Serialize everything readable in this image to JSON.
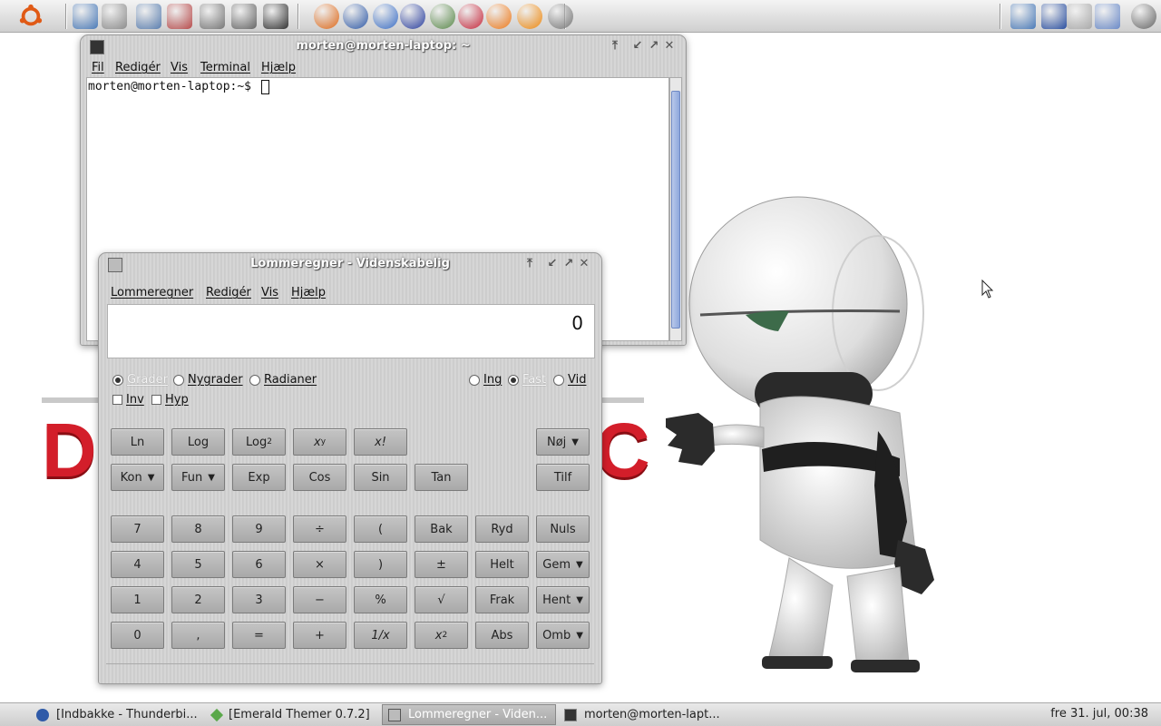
{
  "top_panel": {
    "launchers": [
      {
        "icon": "ubuntu-menu-icon",
        "color": "#e05a16"
      },
      {
        "icon": "home-folder-icon",
        "color": "#4a7ab8"
      },
      {
        "icon": "trash-icon",
        "color": "#8d8d8d"
      },
      {
        "icon": "computer-icon",
        "color": "#5b7fb0"
      },
      {
        "icon": "package-manager-icon",
        "color": "#b84b4b"
      },
      {
        "icon": "printer-icon",
        "color": "#777777"
      },
      {
        "icon": "settings-gear-icon",
        "color": "#666666"
      },
      {
        "icon": "terminal-icon",
        "color": "#333333"
      },
      {
        "icon": "firefox-icon",
        "color": "#e06a1a"
      },
      {
        "icon": "thunderbird-icon",
        "color": "#2f5aa8"
      },
      {
        "icon": "google-earth-icon",
        "color": "#3b6fc7"
      },
      {
        "icon": "gnome-foot-icon",
        "color": "#2a3fa0"
      },
      {
        "icon": "users-icon",
        "color": "#5a8a4a"
      },
      {
        "icon": "miro-icon",
        "color": "#c8283c"
      },
      {
        "icon": "phoenix-icon",
        "color": "#f07a1a"
      },
      {
        "icon": "vlc-cone-icon",
        "color": "#f08a10"
      },
      {
        "icon": "calculator-icon",
        "color": "#777777"
      }
    ],
    "tray": [
      {
        "icon": "desktop-icon",
        "color": "#4a7ab8"
      },
      {
        "icon": "network-signal-icon",
        "color": "#2a4fa0"
      },
      {
        "icon": "brightness-sun-icon",
        "color": "#aaaaaa"
      },
      {
        "icon": "display-switch-icon",
        "color": "#6a8ac8"
      },
      {
        "icon": "power-icon",
        "color": "#666666"
      }
    ]
  },
  "terminal": {
    "title": "morten@morten-laptop: ~",
    "menu": [
      "Fil",
      "Redigér",
      "Vis",
      "Terminal",
      "Hjælp"
    ],
    "prompt": "morten@morten-laptop:~$"
  },
  "calculator": {
    "title": "Lommeregner - Videnskabelig",
    "menu": [
      "Lommeregner",
      "Redigér",
      "Vis",
      "Hjælp"
    ],
    "display": "0",
    "angle_units": {
      "options": [
        "Grader",
        "Nygrader",
        "Radianer"
      ],
      "selected": "Grader"
    },
    "modifiers": [
      "Inv",
      "Hyp"
    ],
    "notation": {
      "options": [
        "Ing",
        "Fast",
        "Vid"
      ],
      "selected": "Fast"
    },
    "function_rows": [
      [
        "Ln",
        "Log",
        "Log",
        "x",
        "x!"
      ],
      [
        "Kon",
        "Fun",
        "Exp",
        "Cos",
        "Sin",
        "Tan"
      ]
    ],
    "log2_sub": "2",
    "xy_sup": "y",
    "right_buttons": [
      "Nøj",
      "Tilf"
    ],
    "keypad": [
      [
        "7",
        "8",
        "9",
        "÷",
        "(",
        "Bak",
        "Ryd",
        "Nuls"
      ],
      [
        "4",
        "5",
        "6",
        "×",
        ")",
        "±",
        "Helt",
        "Gem"
      ],
      [
        "1",
        "2",
        "3",
        "−",
        "%",
        "√",
        "Frak",
        "Hent"
      ],
      [
        "0",
        ",",
        "=",
        "+",
        "1/x",
        "x",
        "Abs",
        "Omb"
      ]
    ],
    "x2_sup": "2"
  },
  "wallpaper": {
    "left_letter": "D",
    "right_letter": "C"
  },
  "taskbar": {
    "tasks": [
      {
        "label": "[Indbakke - Thunderbi...",
        "icon": "thunderbird-icon",
        "color": "#2f5aa8"
      },
      {
        "label": "[Emerald Themer 0.7.2]",
        "icon": "emerald-icon",
        "color": "#5aa84a"
      },
      {
        "label": "Lommeregner - Viden...",
        "icon": "calculator-icon",
        "color": "#777777"
      },
      {
        "label": "morten@morten-lapt...",
        "icon": "terminal-icon",
        "color": "#333333"
      }
    ],
    "clock": "fre 31. jul, 00:38"
  }
}
